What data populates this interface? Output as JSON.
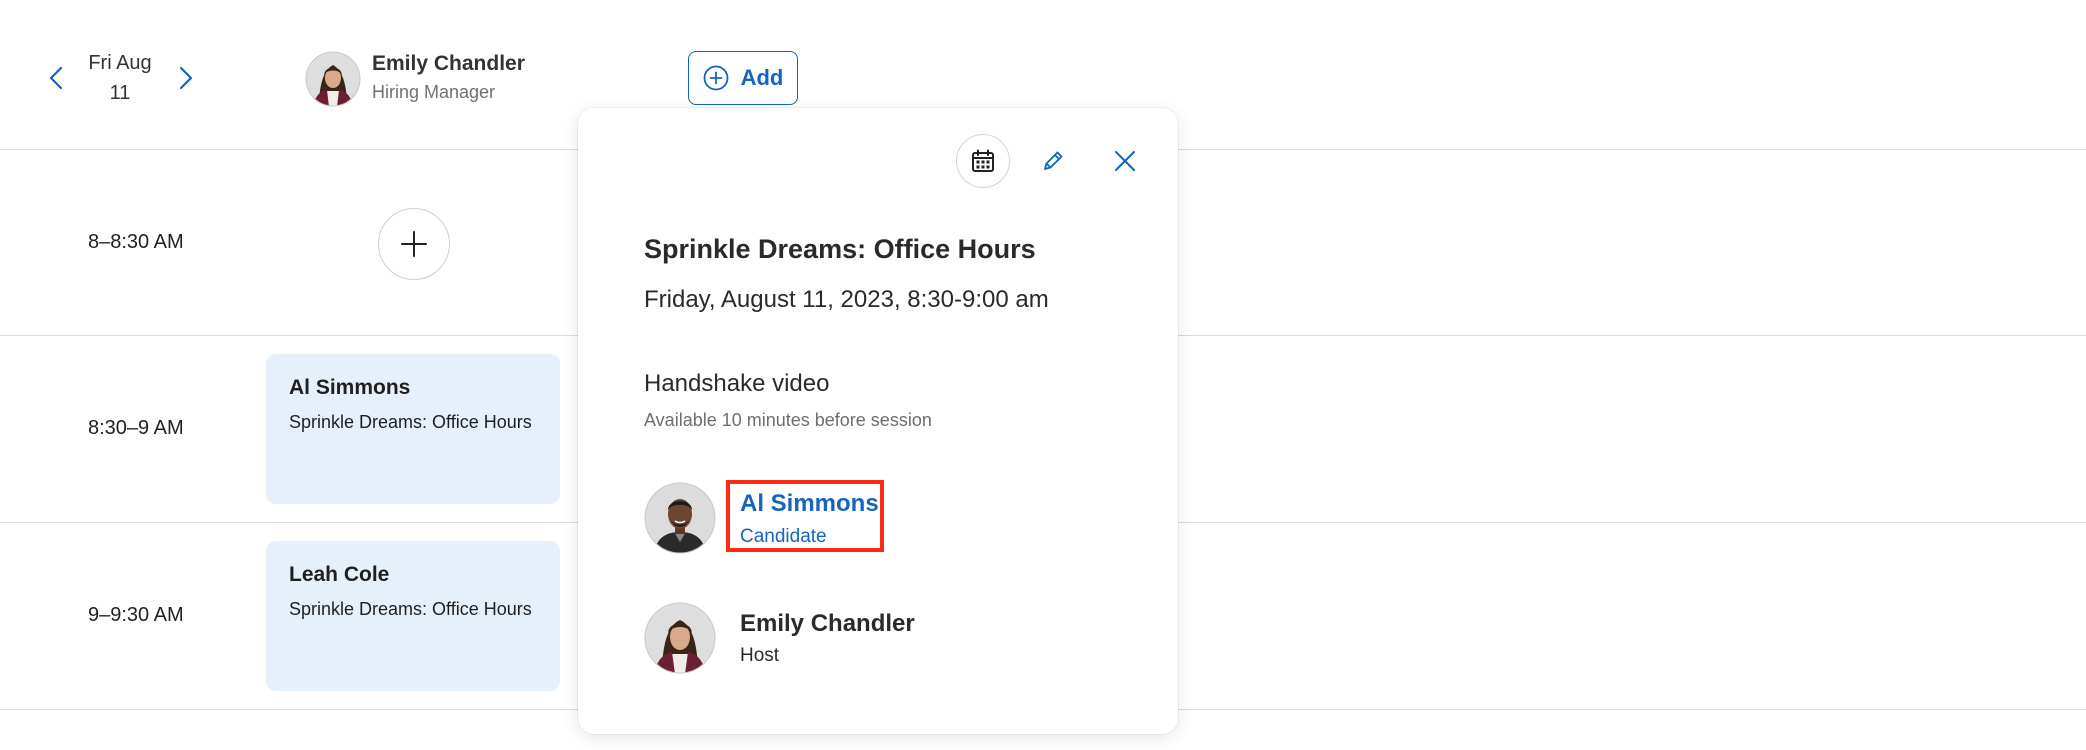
{
  "header": {
    "date_line1": "Fri Aug",
    "date_line2": "11",
    "host": {
      "name": "Emily Chandler",
      "role": "Hiring Manager"
    },
    "add_label": "Add"
  },
  "time_slots": [
    {
      "label": "8–8:30 AM"
    },
    {
      "label": "8:30–9 AM"
    },
    {
      "label": "9–9:30 AM"
    }
  ],
  "slot_cards": [
    {
      "name": "Al Simmons",
      "description": "Sprinkle Dreams: Office Hours"
    },
    {
      "name": "Leah Cole",
      "description": "Sprinkle Dreams: Office Hours"
    }
  ],
  "popover": {
    "title": "Sprinkle Dreams: Office Hours",
    "datetime": "Friday, August 11, 2023, 8:30-9:00 am",
    "location": "Handshake video",
    "location_note": "Available 10 minutes before session",
    "participants": [
      {
        "name": "Al Simmons",
        "role": "Candidate"
      },
      {
        "name": "Emily Chandler",
        "role": "Host"
      }
    ]
  },
  "colors": {
    "accent": "#1565c0",
    "card_bg": "#e6f0fb",
    "highlight": "#ff2a13"
  }
}
